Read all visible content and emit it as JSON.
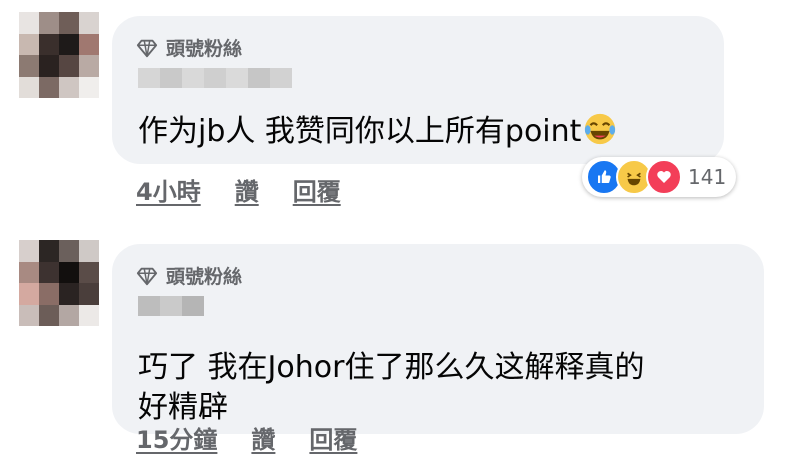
{
  "comments": [
    {
      "badge": "頭號粉絲",
      "text": "作为jb人 我赞同你以上所有point",
      "time": "4小時",
      "like_label": "讚",
      "reply_label": "回覆",
      "reaction_count": "141",
      "reactions": [
        "like",
        "haha",
        "love"
      ]
    },
    {
      "badge": "頭號粉絲",
      "text_line1": "巧了 我在Johor住了那么久这解释真的",
      "text_line2": "好精辟",
      "time": "15分鐘",
      "like_label": "讚",
      "reply_label": "回覆"
    }
  ],
  "colors": {
    "bubble": "#f0f2f5",
    "meta_text": "#65676b",
    "like_blue": "#1877f2",
    "love_red": "#f33e58",
    "haha_yellow": "#f7c948"
  },
  "icons": [
    "top-fan-diamond-icon",
    "laughing-emoji-icon",
    "like-reaction-icon",
    "haha-reaction-icon",
    "love-reaction-icon"
  ]
}
